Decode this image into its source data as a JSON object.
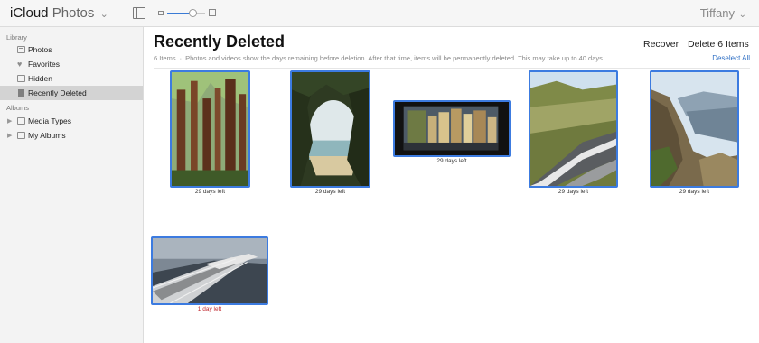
{
  "topbar": {
    "brand_icloud": "iCloud",
    "brand_app": "Photos",
    "brand_chevron": "⌄",
    "user_name": "Tiffany",
    "user_chevron": "⌄",
    "zoom_level": 0.7
  },
  "sidebar": {
    "library_heading": "Library",
    "library_items": [
      {
        "label": "Photos",
        "icon": "photos-icon"
      },
      {
        "label": "Favorites",
        "icon": "heart-icon"
      },
      {
        "label": "Hidden",
        "icon": "hidden-icon"
      },
      {
        "label": "Recently Deleted",
        "icon": "trash-icon",
        "selected": true
      }
    ],
    "albums_heading": "Albums",
    "album_items": [
      {
        "label": "Media Types",
        "icon": "folder-icon"
      },
      {
        "label": "My Albums",
        "icon": "folder-icon"
      }
    ]
  },
  "main": {
    "title": "Recently Deleted",
    "item_count": "6 Items",
    "separator": "·",
    "description": "Photos and videos show the days remaining before deletion. After that time, items will be permanently deleted. This may take up to 40 days.",
    "recover_label": "Recover",
    "delete_label": "Delete 6 Items",
    "deselect_label": "Deselect All"
  },
  "photos": [
    {
      "subject": "redwood-forest",
      "caption": "29 days left",
      "selected": true
    },
    {
      "subject": "lake-through-trees",
      "caption": "29 days left",
      "selected": true
    },
    {
      "subject": "street-buildings",
      "caption": "29 days left",
      "selected": true
    },
    {
      "subject": "mountain-road",
      "caption": "29 days left",
      "selected": true
    },
    {
      "subject": "cliffs-valley",
      "caption": "29 days left",
      "selected": true
    },
    {
      "subject": "pier-walkway",
      "caption": "1 day left",
      "selected": true
    }
  ],
  "colors": {
    "selection": "#3c7be0",
    "accent_link": "#2f6fc4",
    "urgent": "#c0282e"
  }
}
